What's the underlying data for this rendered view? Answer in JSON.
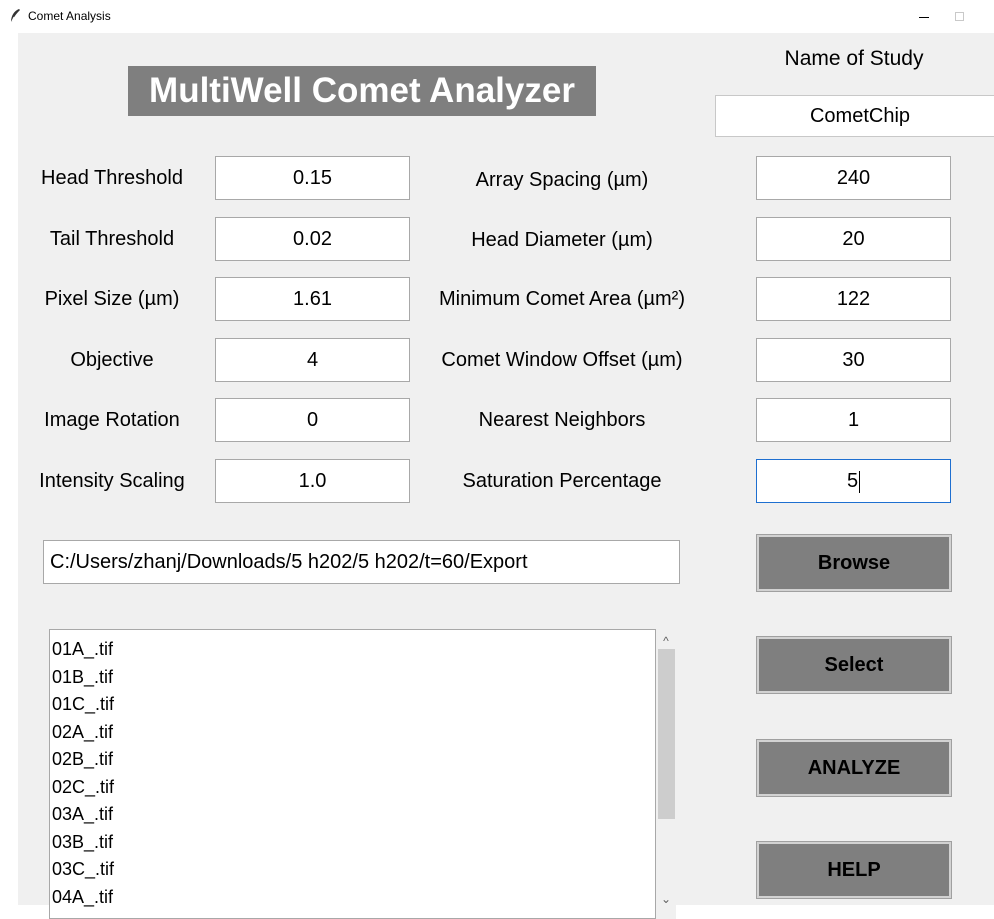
{
  "window": {
    "title": "Comet Analysis",
    "icon": "feather-icon",
    "controls": [
      "minimize-icon",
      "maximize-icon"
    ]
  },
  "app_title": "MultiWell Comet Analyzer",
  "study": {
    "label": "Name of Study",
    "value": "CometChip"
  },
  "params_left": [
    {
      "label": "Head Threshold",
      "value": "0.15"
    },
    {
      "label": "Tail Threshold",
      "value": "0.02"
    },
    {
      "label": "Pixel Size (µm)",
      "value": "1.61"
    },
    {
      "label": "Objective",
      "value": "4"
    },
    {
      "label": "Image Rotation",
      "value": "0"
    },
    {
      "label": "Intensity Scaling",
      "value": "1.0"
    }
  ],
  "params_right": [
    {
      "label": "Array Spacing (µm)",
      "value": "240"
    },
    {
      "label": "Head Diameter (µm)",
      "value": "20"
    },
    {
      "label": "Minimum Comet Area (µm²)",
      "value": "122"
    },
    {
      "label": "Comet Window Offset (µm)",
      "value": "30"
    },
    {
      "label": "Nearest Neighbors",
      "value": "1"
    },
    {
      "label": "Saturation Percentage",
      "value": "5"
    }
  ],
  "path": "C:/Users/zhanj/Downloads/5 h202/5 h202/t=60/Export",
  "buttons": {
    "browse": "Browse",
    "select": "Select",
    "analyze": "ANALYZE",
    "help": "HELP"
  },
  "files": [
    "01A_.tif",
    "01B_.tif",
    "01C_.tif",
    "02A_.tif",
    "02B_.tif",
    "02C_.tif",
    "03A_.tif",
    "03B_.tif",
    "03C_.tif",
    "04A_.tif"
  ],
  "scrollbar": {
    "up_arrow": "^",
    "down_arrow": "⌄"
  },
  "colors": {
    "button_bg": "#7f7f7f",
    "title_bg": "#7f7f7f",
    "window_bg": "#f0f0f0",
    "focus_border": "#1e6fd0"
  }
}
